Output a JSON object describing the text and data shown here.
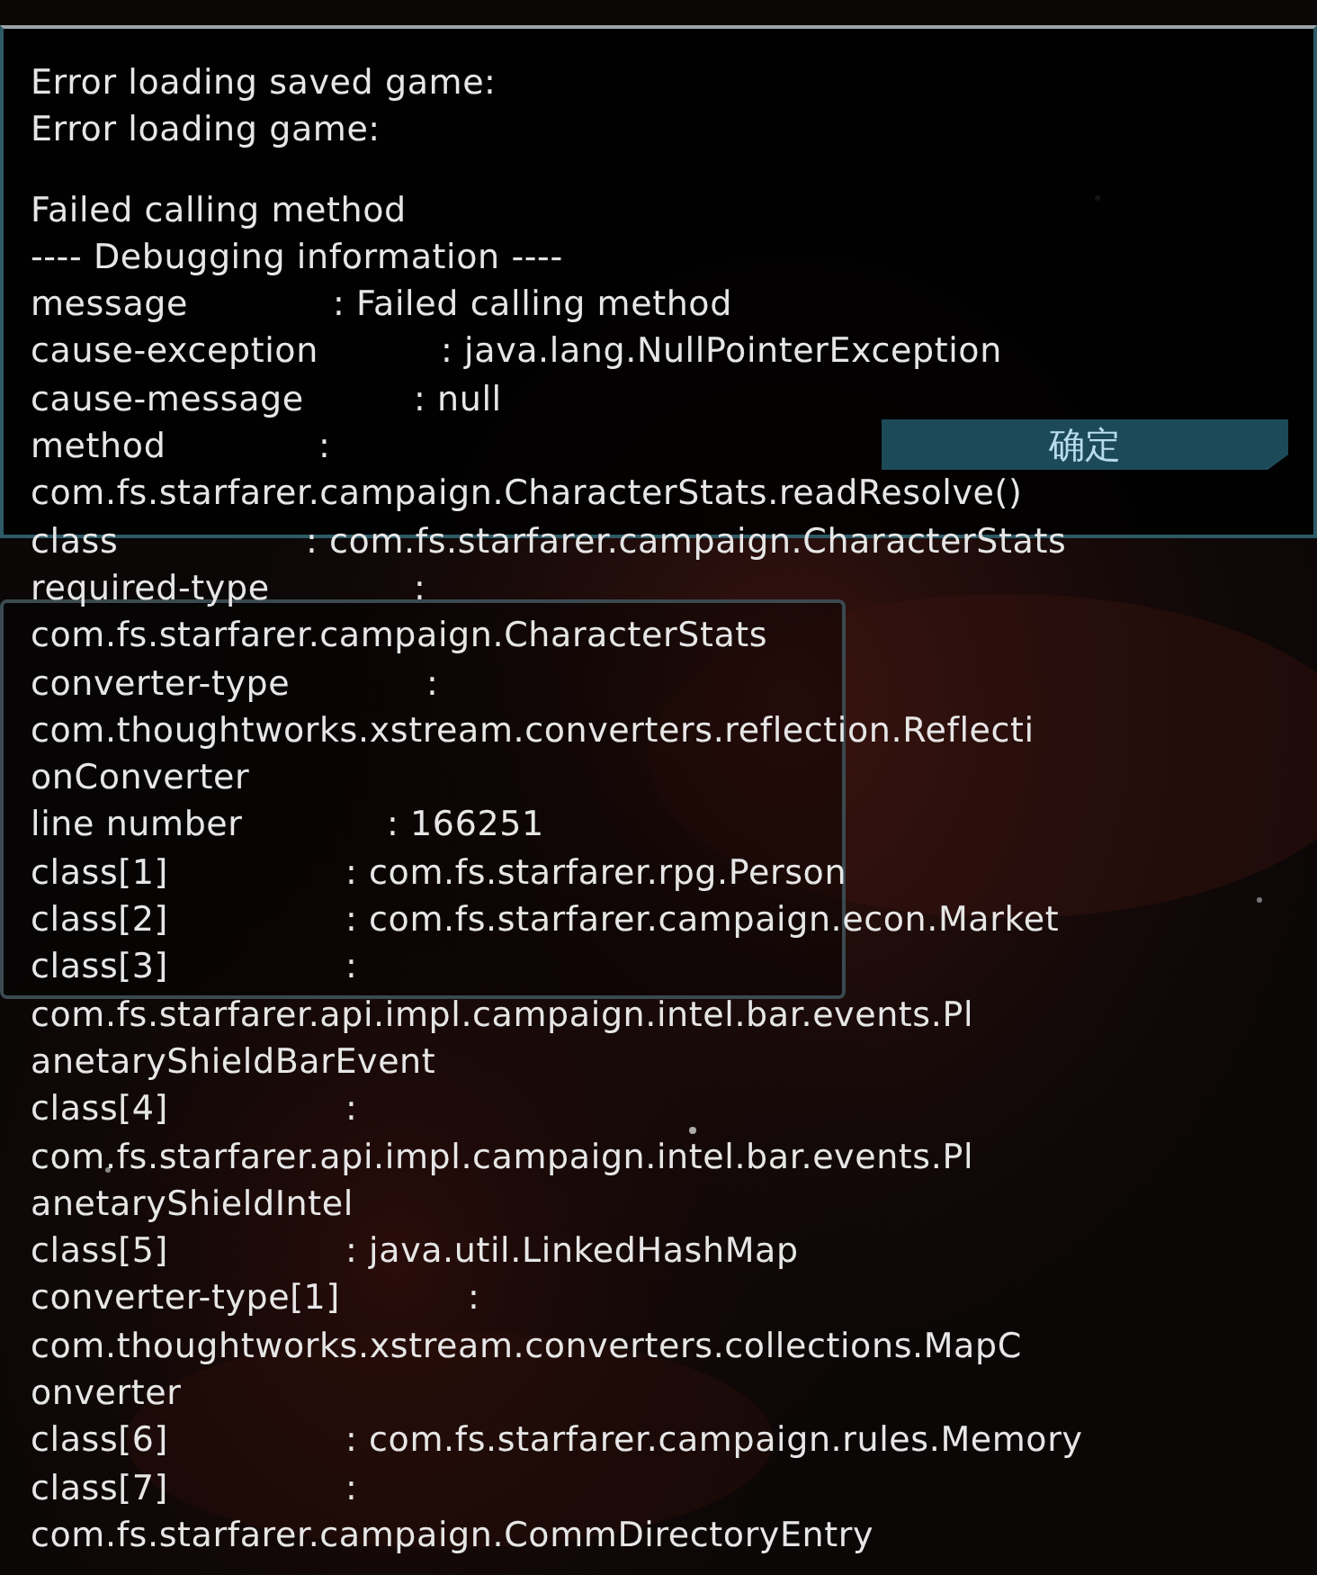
{
  "dialog": {
    "header": [
      "Error loading saved game:",
      "Error loading game:"
    ],
    "lines": [
      {
        "text": "Failed calling method"
      },
      {
        "text": "---- Debugging information ----"
      },
      {
        "label": "message",
        "value": ": Failed calling method"
      },
      {
        "label": "cause-exception",
        "value": ": java.lang.NullPointerException"
      },
      {
        "label": "cause-message",
        "value": ": null"
      },
      {
        "label": "method",
        "value": ":"
      },
      {
        "text": "com.fs.starfarer.campaign.CharacterStats.readResolve()"
      },
      {
        "label": "class",
        "value": ": com.fs.starfarer.campaign.CharacterStats"
      },
      {
        "label": "required-type",
        "value": ":"
      },
      {
        "text": "com.fs.starfarer.campaign.CharacterStats"
      },
      {
        "label": "converter-type",
        "value": ":"
      },
      {
        "text": "com.thoughtworks.xstream.converters.reflection.Reflecti"
      },
      {
        "text": "onConverter"
      },
      {
        "label": "line number",
        "value": ": 166251"
      },
      {
        "label": "class[1]",
        "value": ": com.fs.starfarer.rpg.Person"
      },
      {
        "label": "class[2]",
        "value": ": com.fs.starfarer.campaign.econ.Market"
      },
      {
        "label": "class[3]",
        "value": ":"
      },
      {
        "text": "com.fs.starfarer.api.impl.campaign.intel.bar.events.Pl"
      },
      {
        "text": "anetaryShieldBarEvent"
      },
      {
        "label": "class[4]",
        "value": ":"
      },
      {
        "text": "com.fs.starfarer.api.impl.campaign.intel.bar.events.Pl"
      },
      {
        "text": "anetaryShieldIntel"
      },
      {
        "label": "class[5]",
        "value": ": java.util.LinkedHashMap"
      },
      {
        "label": "converter-type[1]",
        "value": ":"
      },
      {
        "text": "com.thoughtworks.xstream.converters.collections.MapC"
      },
      {
        "text": "onverter"
      },
      {
        "label": "class[6]",
        "value": ": com.fs.starfarer.campaign.rules.Memory"
      },
      {
        "label": "class[7]",
        "value": ":"
      },
      {
        "text": "com.fs.starfarer.campaign.CommDirectoryEntry"
      }
    ],
    "confirm_button": "确定"
  }
}
